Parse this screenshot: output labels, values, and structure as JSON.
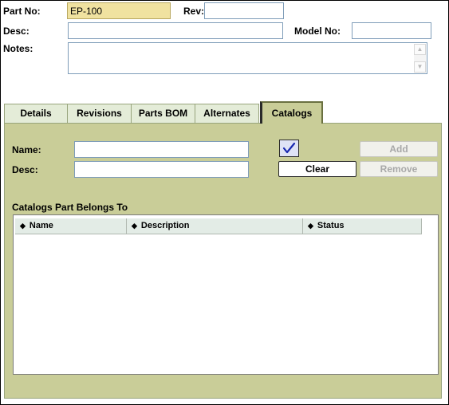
{
  "header": {
    "part_no_label": "Part No:",
    "part_no_value": "EP-100",
    "rev_label": "Rev:",
    "rev_value": "",
    "desc_label": "Desc:",
    "desc_value": "",
    "model_no_label": "Model No:",
    "model_no_value": "",
    "notes_label": "Notes:",
    "notes_value": ""
  },
  "tabs": [
    {
      "label": "Details"
    },
    {
      "label": "Revisions"
    },
    {
      "label": "Parts BOM"
    },
    {
      "label": "Alternates"
    },
    {
      "label": "Catalogs",
      "active": true
    }
  ],
  "catalogs": {
    "name_label": "Name:",
    "name_value": "",
    "desc_label": "Desc:",
    "desc_value": "",
    "check_icon": "checkmark-icon",
    "add_label": "Add",
    "clear_label": "Clear",
    "remove_label": "Remove",
    "section_title": "Catalogs Part Belongs To",
    "columns": [
      "Name",
      "Description",
      "Status"
    ],
    "rows": []
  },
  "colors": {
    "panel": "#c9cd98",
    "highlight_field": "#f0e2a0",
    "check_blue": "#1a2ab0"
  }
}
